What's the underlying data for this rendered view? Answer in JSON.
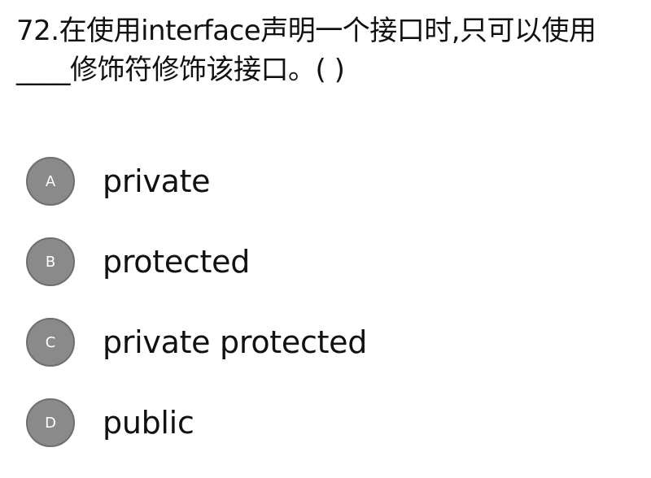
{
  "question": {
    "text": "72.在使用interface声明一个接口时,只可以使用____修饰符修饰该接口。( )"
  },
  "options": [
    {
      "letter": "A",
      "text": "private"
    },
    {
      "letter": "B",
      "text": "protected"
    },
    {
      "letter": "C",
      "text": "private protected"
    },
    {
      "letter": "D",
      "text": "public"
    }
  ],
  "colors": {
    "circle_fill": "#8a8a8a",
    "circle_border": "#6e6e6e",
    "text": "#111111",
    "background": "#ffffff"
  }
}
